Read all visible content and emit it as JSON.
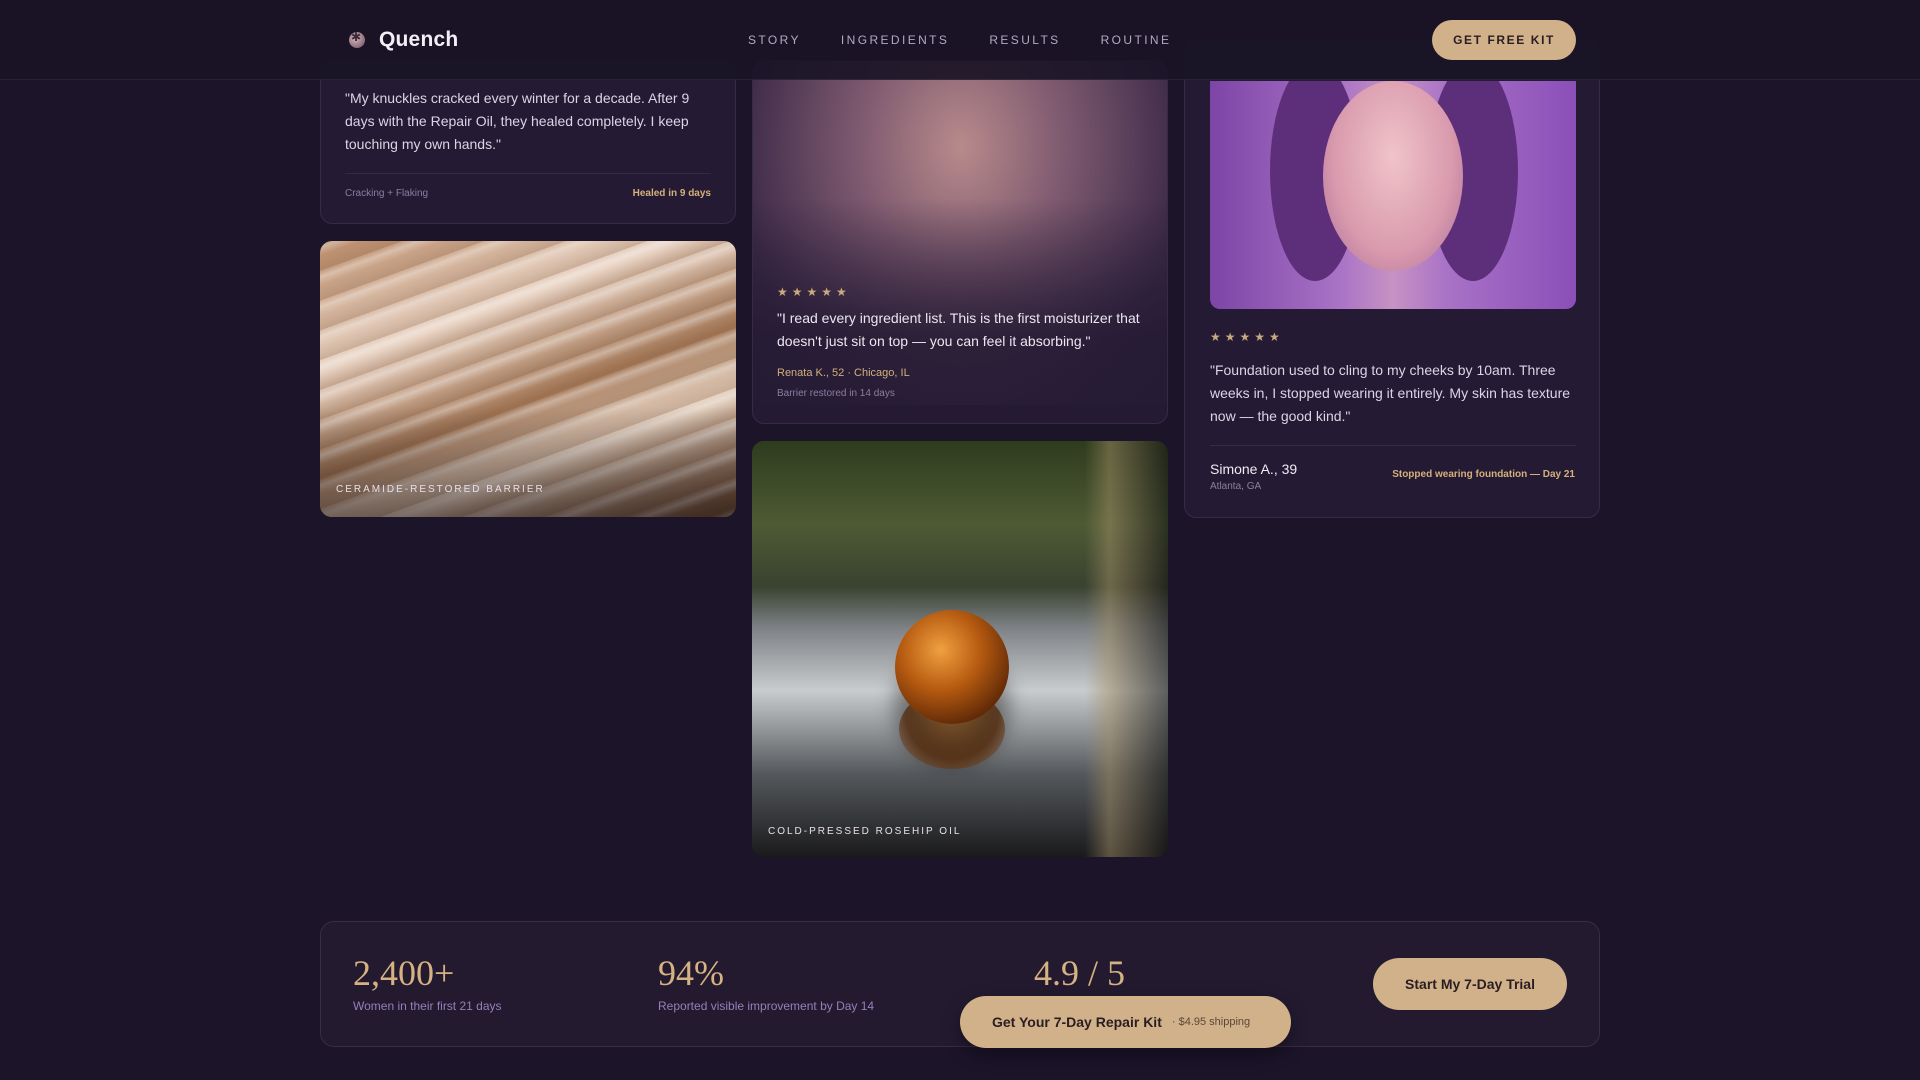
{
  "nav": {
    "brand": "Quench",
    "links": [
      "STORY",
      "INGREDIENTS",
      "RESULTS",
      "ROUTINE"
    ],
    "cta": "GET FREE KIT"
  },
  "testimonials": {
    "t1": {
      "quote": "\"My knuckles cracked every winter for a decade. After 9 days with the Repair Oil, they healed completely. I keep touching my own hands.\"",
      "tag": "Cracking + Flaking",
      "result": "Healed in 9 days"
    },
    "t2": {
      "stars": "★★★★★",
      "quote": "\"I read every ingredient list. This is the first moisturizer that doesn't just sit on top — you can feel it absorbing.\"",
      "author": "Renata K., 52 · Chicago, IL",
      "result": "Barrier restored in 14 days"
    },
    "t3": {
      "stars": "★★★★★",
      "quote": "\"Foundation used to cling to my cheeks by 10am. Three weeks in, I stopped wearing it entirely. My skin has texture now — the good kind.\"",
      "author": "Simone A., 39",
      "location": "Atlanta, GA",
      "result": "Stopped wearing foundation — Day 21"
    }
  },
  "images": {
    "barrier_label": "CERAMIDE-RESTORED BARRIER",
    "oil_label": "COLD-PRESSED ROSEHIP OIL"
  },
  "stats": [
    {
      "value": "2,400+",
      "label": "Women in their first 21 days"
    },
    {
      "value": "94%",
      "label": "Reported visible improvement by Day 14"
    },
    {
      "value": "4.9 / 5",
      "label": ""
    }
  ],
  "trial_cta": "Start My 7-Day Trial",
  "sticky_cta": {
    "main": "Get Your 7-Day Repair Kit",
    "sub": "· $4.95 shipping"
  },
  "colors": {
    "background": "#1c1429",
    "card": "#241a33",
    "accent": "#d1b18a",
    "muted": "#9380b8"
  }
}
